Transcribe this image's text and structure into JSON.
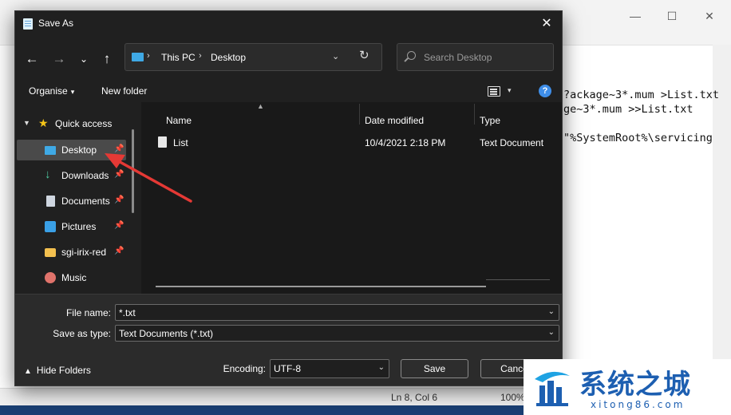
{
  "notepad": {
    "window_controls": {
      "minimize": "—",
      "maximize": "☐",
      "close": "✕"
    },
    "editor_lines": [
      "?ackage~3*.mum >List.txt",
      "ge~3*.mum >>List.txt",
      "\"%SystemRoot%\\servicing"
    ],
    "status": {
      "position": "Ln 8, Col 6",
      "zoom": "100%"
    }
  },
  "dialog": {
    "title": "Save As",
    "close_glyph": "✕",
    "nav": {
      "back": "←",
      "forward": "→",
      "recent": "⌄",
      "up": "↑"
    },
    "address": {
      "segments": [
        "This PC",
        "Desktop"
      ],
      "separator": "›",
      "dropdown": "⌄",
      "refresh": "↻"
    },
    "search": {
      "placeholder": "Search Desktop"
    },
    "commandbar": {
      "organise": "Organise",
      "new_folder": "New folder",
      "caret": "▾",
      "help": "?"
    },
    "navpane": {
      "quick_access": "Quick access",
      "items": [
        {
          "label": "Desktop",
          "icon": "desktop-icon",
          "pinned": true
        },
        {
          "label": "Downloads",
          "icon": "downloads-icon",
          "pinned": true
        },
        {
          "label": "Documents",
          "icon": "documents-icon",
          "pinned": true
        },
        {
          "label": "Pictures",
          "icon": "pictures-icon",
          "pinned": true
        },
        {
          "label": "sgi-irix-red",
          "icon": "folder-icon",
          "pinned": true
        },
        {
          "label": "Music",
          "icon": "music-icon",
          "pinned": false
        }
      ],
      "pin_glyph": "📌"
    },
    "filelist": {
      "columns": [
        "Name",
        "Date modified",
        "Type"
      ],
      "rows": [
        {
          "name": "List",
          "date": "10/4/2021 2:18 PM",
          "type": "Text Document"
        }
      ]
    },
    "fields": {
      "file_name_label": "File name:",
      "file_name_value": "*.txt",
      "save_type_label": "Save as type:",
      "save_type_value": "Text Documents (*.txt)",
      "encoding_label": "Encoding:",
      "encoding_value": "UTF-8"
    },
    "hide_folders": "Hide Folders",
    "buttons": {
      "save": "Save",
      "cancel": "Cance"
    }
  },
  "watermark": {
    "text": "系统之城",
    "url": "xitong86.com"
  },
  "colors": {
    "accent": "#3f8ee8",
    "arrow": "#e53935",
    "dialog_bg": "#202020"
  }
}
